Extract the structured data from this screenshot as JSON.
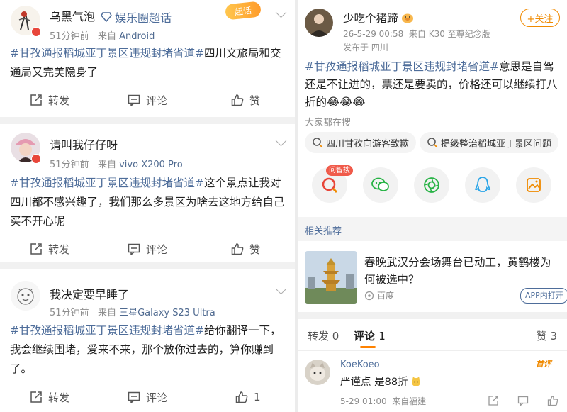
{
  "left_feed": {
    "posts": [
      {
        "username": "乌黑气泡",
        "badge": "娱乐圈超话",
        "corner_badge": "超话",
        "time": "51分钟前",
        "from_prefix": "来自",
        "device": "Android",
        "hashtag": "#甘孜通报稻城亚丁景区违规封堵省道#",
        "text": "四川文旅局和交通局又完美隐身了",
        "repost": "转发",
        "comment": "评论",
        "like": "赞"
      },
      {
        "username": "请叫我仔仔呀",
        "time": "51分钟前",
        "from_prefix": "来自",
        "device": "vivo X200 Pro",
        "hashtag": "#甘孜通报稻城亚丁景区违规封堵省道#",
        "text": "这个景点让我对四川都不感兴趣了，我们那么多景区为啥去这地方给自己买不开心呢",
        "repost": "转发",
        "comment": "评论",
        "like": "赞"
      },
      {
        "username": "我决定要早睡了",
        "time": "51分钟前",
        "from_prefix": "来自",
        "device": "三星Galaxy S23 Ultra",
        "hashtag": "#甘孜通报稻城亚丁景区违规封堵省道#",
        "text": "给你翻译一下，我会继续围堵，爱来不来，那个放你过去的，算你赚到了。",
        "repost": "转发",
        "comment": "评论",
        "like": "1"
      }
    ]
  },
  "right_detail": {
    "author": {
      "username": "少吃个猪蹄",
      "datetime": "26-5-29 00:58",
      "from_prefix": "来自",
      "device": "K30 至尊纪念版",
      "location": "发布于 四川",
      "follow_button": "+关注"
    },
    "hashtag": "#甘孜通报稻城亚丁景区违规封堵省道#",
    "text": "意思是自驾还是不让进的，票还是要卖的，价格还可以继续打八折的",
    "emoji": "😂😂😂",
    "search_label": "大家都在搜",
    "search_chips": [
      "四川甘孜向游客致歉",
      "提级整治稻城亚丁景区问题"
    ],
    "share_badge": "问智搜",
    "share_icons": [
      "search-ai-icon",
      "wechat-icon",
      "moments-icon",
      "qq-icon",
      "save-image-icon"
    ],
    "related": {
      "label": "相关推荐",
      "title": "春晚武汉分会场舞台已动工，黄鹤楼为何被选中？",
      "source": "百度",
      "open_button": "APP内打开"
    },
    "tabs": {
      "repost": "转发",
      "repost_count": "0",
      "comment": "评论",
      "comment_count": "1",
      "like": "赞",
      "like_count": "3"
    },
    "comment": {
      "username": "KoeKoeo",
      "badge": "首评",
      "text": "严谨点 是88折",
      "time": "5-29 01:00",
      "location": "来自福建"
    }
  },
  "colors": {
    "hashtag": "#4e6d9a",
    "follow": "#f08a00",
    "active_tab_underline": "#ff8200"
  }
}
